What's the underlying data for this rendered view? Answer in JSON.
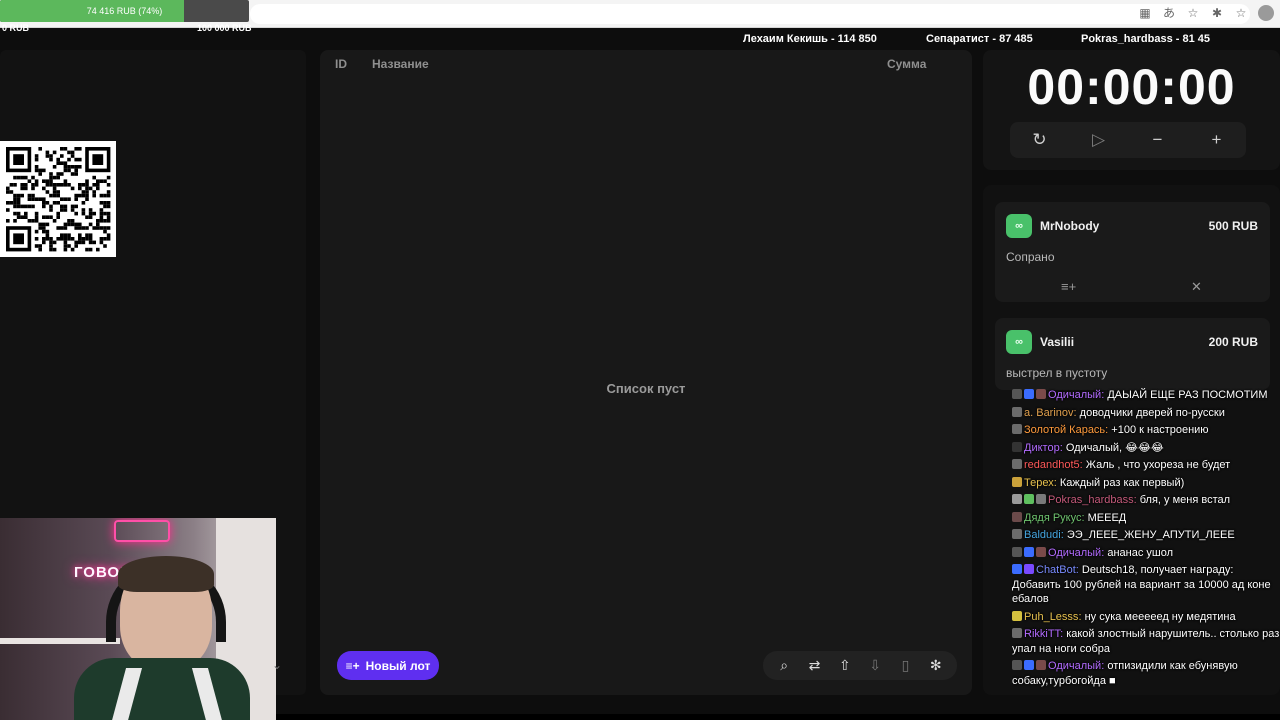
{
  "browser": {
    "address_ghost_text": "",
    "icons": [
      "apps-icon",
      "translate-icon",
      "star-icon",
      "extensions-icon",
      "bookmark-icon",
      "profile-avatar"
    ]
  },
  "progress": {
    "label": "74 416 RUB (74%)",
    "percent": 74,
    "left_value": "0 RUB",
    "right_value": "100 000 RUB",
    "fill_color": "#5cb85c"
  },
  "leaders": [
    {
      "text": "Лехаим Кекишь - 114 850"
    },
    {
      "text": "Сепаратист - 87 485"
    },
    {
      "text": "Pokras_hardbass - 81 45"
    }
  ],
  "lots": {
    "columns": {
      "id": "ID",
      "name": "Название",
      "sum": "Сумма"
    },
    "empty_text": "Список пуст",
    "new_button": "Новый лот",
    "new_button_color": "#5f2ff0",
    "toolbar_icons": [
      "search-icon",
      "shuffle-icon",
      "upload-icon",
      "download-icon",
      "trash-icon",
      "wheel-icon"
    ]
  },
  "timer": {
    "display": "00:00:00",
    "controls": [
      "reset-icon",
      "play-icon",
      "minus-icon",
      "plus-icon"
    ]
  },
  "donations": [
    {
      "icon": "∞",
      "name": "MrNobody",
      "amount": "500 RUB",
      "message": "Сопрано"
    },
    {
      "icon": "∞",
      "name": "Vasilii",
      "amount": "200 RUB",
      "message": "выстрел в пустоту"
    }
  ],
  "chat": [
    {
      "user": "Одичалый",
      "color": "#b36cff",
      "badges": [
        "#555",
        "#3b6cff",
        "#7a4a4a"
      ],
      "text": "ДАЫАЙ ЕЩЕ РАЗ ПОСМОТИМ"
    },
    {
      "user": "a. Barinov",
      "color": "#e3a24f",
      "badges": [
        "#6b6b6b"
      ],
      "text": "доводчики дверей по-русски"
    },
    {
      "user": "Золотой Карась",
      "color": "#ff9b3d",
      "badges": [
        "#6b6b6b"
      ],
      "text": "+100 к настроению"
    },
    {
      "user": "Диктор",
      "color": "#b36cff",
      "badges": [
        "#333"
      ],
      "text": "Одичалый, 😂😂😂"
    },
    {
      "user": "redandhot5",
      "color": "#ff5a5a",
      "badges": [
        "#6b6b6b"
      ],
      "text": "Жаль , что ухореза не будет"
    },
    {
      "user": "Терех",
      "color": "#e8c24f",
      "badges": [
        "#caa13a"
      ],
      "text": "Каждый раз как первый)"
    },
    {
      "user": "Pokras_hardbass",
      "color": "#c45a7a",
      "badges": [
        "#9a9a9a",
        "#5fbf5f",
        "#7a7a7a"
      ],
      "text": "бля, у меня встал"
    },
    {
      "user": "Дядя Рукус",
      "color": "#6fc36f",
      "badges": [
        "#6b4a4a"
      ],
      "text": "МЕЕЕД"
    },
    {
      "user": "Baldudi",
      "color": "#46a6e0",
      "badges": [
        "#6b6b6b"
      ],
      "text": "ЭЭ_ЛЕЕЕ_ЖЕНУ_АПУТИ_ЛЕЕЕ"
    },
    {
      "user": "Одичалый",
      "color": "#b36cff",
      "badges": [
        "#555",
        "#3b6cff",
        "#7a4a4a"
      ],
      "text": "ананас ушол"
    },
    {
      "user": "ChatBot",
      "color": "#7a8cff",
      "badges": [
        "#3b6cff",
        "#7a4aff"
      ],
      "text": "Deutsch18, получает награду: Добавить 100 рублей на вариант за 10000 ад коне ебалов"
    },
    {
      "user": "Puh_Lesss",
      "color": "#e8c24f",
      "badges": [
        "#d6c23f"
      ],
      "text": "ну сука мееееед ну медятина"
    },
    {
      "user": "RikkiTT",
      "color": "#b36cff",
      "badges": [
        "#6b6b6b"
      ],
      "text": "какой злостный нарушитель.. столько раз упал на ноги собра"
    },
    {
      "user": "Одичалый",
      "color": "#b36cff",
      "badges": [
        "#555",
        "#3b6cff",
        "#7a4a4a"
      ],
      "text": "отпизидили как ебунявую собаку,турбогойда ■"
    }
  ],
  "webcam": {
    "neon_text": "ГОВОРЦ        AZ"
  }
}
